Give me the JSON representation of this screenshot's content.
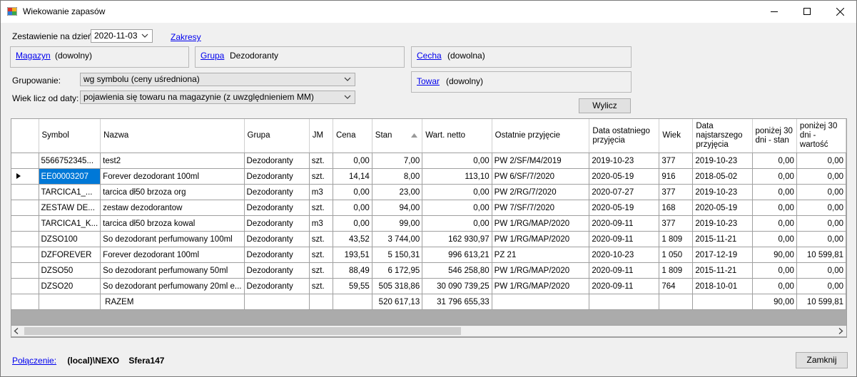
{
  "window": {
    "title": "Wiekowanie zapasów"
  },
  "filters": {
    "date_label": "Zestawienie na dzień:",
    "date_value": "2020-11-03",
    "zakresy": "Zakresy",
    "magazyn_label": "Magazyn",
    "magazyn_value": "(dowolny)",
    "grupa_label": "Grupa",
    "grupa_value": "Dezodoranty",
    "cecha_label": "Cecha",
    "cecha_value": "(dowolna)",
    "towar_label": "Towar",
    "towar_value": "(dowolny)",
    "grupowanie_label": "Grupowanie:",
    "grupowanie_value": "wg symbolu (ceny uśredniona)",
    "wiek_label": "Wiek licz od daty:",
    "wiek_value": "pojawienia się towaru na magazynie (z uwzględnieniem MM)",
    "wylicz": "Wylicz"
  },
  "grid": {
    "headers": [
      "Symbol",
      "Nazwa",
      "Grupa",
      "JM",
      "Cena",
      "Stan",
      "Wart. netto",
      "Ostatnie przyjęcie",
      "Data ostatniego przyjęcia",
      "Wiek",
      "Data najstarszego przyjęcia",
      "poniżej 30 dni - stan",
      "poniżej 30 dni - wartość"
    ],
    "rows": [
      [
        "5566752345...",
        "test2",
        "Dezodoranty",
        "szt.",
        "0,00",
        "7,00",
        "0,00",
        "PW 2/SF/M4/2019",
        "2019-10-23",
        "377",
        "2019-10-23",
        "0,00",
        "0,00"
      ],
      [
        "EE00003207",
        "Forever dezodorant 100ml",
        "Dezodoranty",
        "szt.",
        "14,14",
        "8,00",
        "113,10",
        "PW 6/SF/7/2020",
        "2020-05-19",
        "916",
        "2018-05-02",
        "0,00",
        "0,00"
      ],
      [
        "TARCICA1_...",
        "tarcica dł50 brzoza org",
        "Dezodoranty",
        "m3",
        "0,00",
        "23,00",
        "0,00",
        "PW 2/RG/7/2020",
        "2020-07-27",
        "377",
        "2019-10-23",
        "0,00",
        "0,00"
      ],
      [
        "ZESTAW DE...",
        "zestaw dezodorantow",
        "Dezodoranty",
        "szt.",
        "0,00",
        "94,00",
        "0,00",
        "PW 7/SF/7/2020",
        "2020-05-19",
        "168",
        "2020-05-19",
        "0,00",
        "0,00"
      ],
      [
        "TARCICA1_K...",
        "tarcica dł50 brzoza kowal",
        "Dezodoranty",
        "m3",
        "0,00",
        "99,00",
        "0,00",
        "PW 1/RG/MAP/2020",
        "2020-09-11",
        "377",
        "2019-10-23",
        "0,00",
        "0,00"
      ],
      [
        "DZSO100",
        "So dezodorant perfumowany 100ml",
        "Dezodoranty",
        "szt.",
        "43,52",
        "3 744,00",
        "162 930,97",
        "PW 1/RG/MAP/2020",
        "2020-09-11",
        "1 809",
        "2015-11-21",
        "0,00",
        "0,00"
      ],
      [
        "DZFOREVER",
        "Forever dezodorant 100ml",
        "Dezodoranty",
        "szt.",
        "193,51",
        "5 150,31",
        "996 613,21",
        "PZ 21",
        "2020-10-23",
        "1 050",
        "2017-12-19",
        "90,00",
        "10 599,81"
      ],
      [
        "DZSO50",
        "So dezodorant perfumowany 50ml",
        "Dezodoranty",
        "szt.",
        "88,49",
        "6 172,95",
        "546 258,80",
        "PW 1/RG/MAP/2020",
        "2020-09-11",
        "1 809",
        "2015-11-21",
        "0,00",
        "0,00"
      ],
      [
        "DZSO20",
        "So dezodorant perfumowany 20ml e...",
        "Dezodoranty",
        "szt.",
        "59,55",
        "505 318,86",
        "30 090 739,25",
        "PW 1/RG/MAP/2020",
        "2020-09-11",
        "764",
        "2018-10-01",
        "0,00",
        "0,00"
      ]
    ],
    "total": {
      "label": "RAZEM",
      "stan": "520 617,13",
      "wartosc": "31 796 655,33",
      "ponizej_stan": "90,00",
      "ponizej_wartosc": "10 599,81"
    }
  },
  "footer": {
    "connection_label": "Połączenie:",
    "server": "(local)\\NEXO",
    "database": "Sfera147",
    "close": "Zamknij"
  }
}
